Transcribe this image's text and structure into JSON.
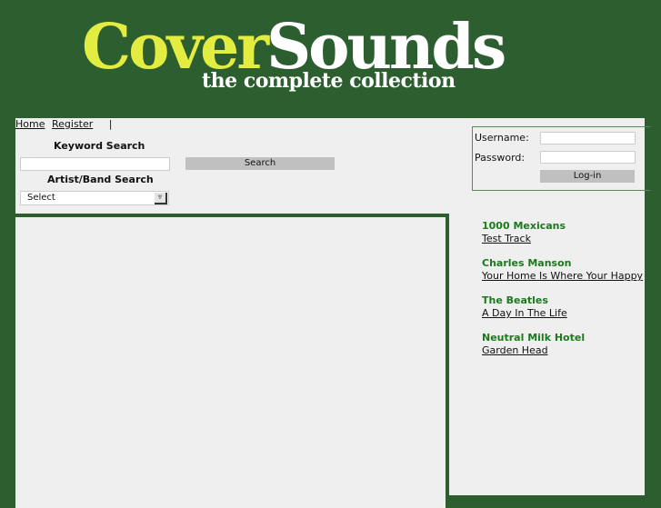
{
  "logo": {
    "word1": "Cover",
    "word2": "Sounds",
    "tagline": "the complete collection",
    "colors": {
      "word1": "#e2ec41",
      "word2": "#ffffff",
      "background": "#2d5e30"
    }
  },
  "nav": {
    "items": [
      {
        "label": "Home"
      },
      {
        "label": "Register"
      }
    ],
    "separator": "|"
  },
  "search": {
    "keyword_title": "Keyword Search",
    "keyword_value": "",
    "button_label": "Search",
    "artist_title": "Artist/Band Search",
    "artist_selected": "Select"
  },
  "login": {
    "username_label": "Username:",
    "password_label": "Password:",
    "username_value": "",
    "password_value": "",
    "button_label": "Log-in"
  },
  "recent": [
    {
      "artist": "1000 Mexicans",
      "track": "Test Track"
    },
    {
      "artist": "Charles Manson",
      "track": "Your Home Is Where Your Happy"
    },
    {
      "artist": "The Beatles",
      "track": "A Day In The Life"
    },
    {
      "artist": "Neutral Milk Hotel",
      "track": "Garden Head"
    }
  ]
}
